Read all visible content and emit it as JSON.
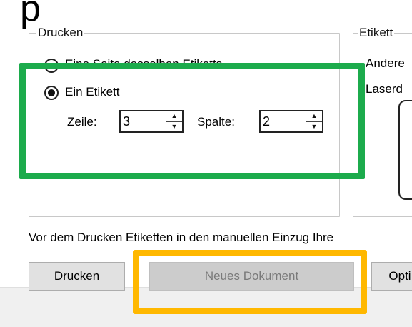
{
  "top_glyph": "p",
  "drucken_group": {
    "title": "Drucken",
    "radio_page": "Eine Seite desselben Etiketts",
    "radio_single": "Ein Etikett",
    "row_label": "Zeile:",
    "row_value": "3",
    "col_label": "Spalte:",
    "col_value": "2"
  },
  "etikett_group": {
    "title": "Etikett",
    "line1": "Andere",
    "line2": "Laserd"
  },
  "info_text": "Vor dem Drucken Etiketten in den manuellen Einzug Ihre",
  "buttons": {
    "print": "Drucken",
    "new_document": "Neues Dokument",
    "options": "Opti"
  },
  "highlight_colors": {
    "green": "#1cab4c",
    "yellow": "#ffb800"
  }
}
